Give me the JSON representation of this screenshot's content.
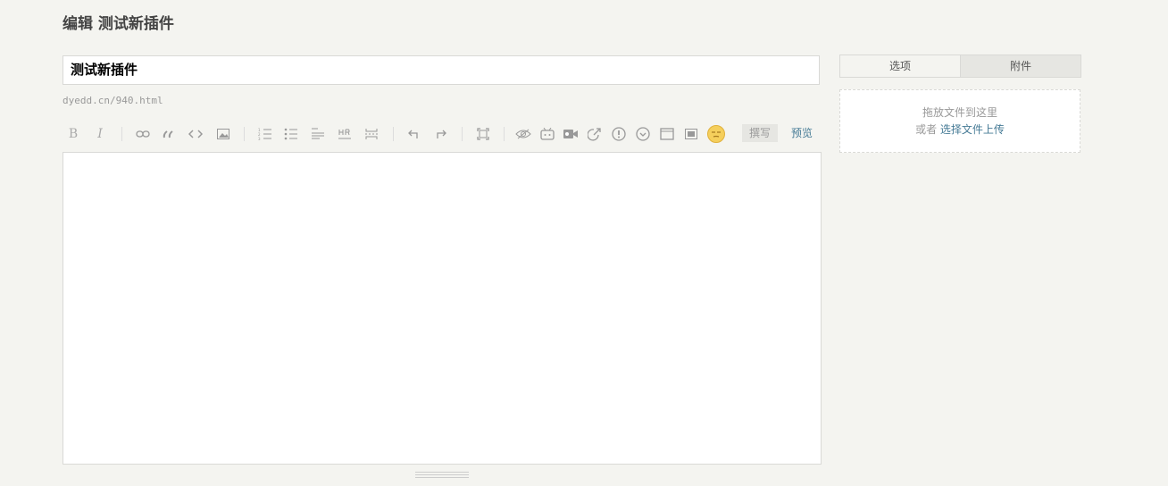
{
  "page": {
    "title": "编辑 测试新插件"
  },
  "post": {
    "title_value": "测试新插件",
    "slug": "dyedd.cn/940.html"
  },
  "toolbar": {
    "bold_label": "B",
    "italic_label": "I",
    "write_label": "撰写",
    "preview_label": "预览",
    "icons": [
      "bold-icon",
      "italic-icon",
      "link-icon",
      "quote-icon",
      "code-icon",
      "image-icon",
      "ordered-list-icon",
      "unordered-list-icon",
      "heading-icon",
      "hr-icon",
      "more-icon",
      "undo-icon",
      "redo-icon",
      "fullscreen-icon",
      "hide-icon",
      "bilibili-icon",
      "video-icon",
      "external-link-icon",
      "alert-icon",
      "collapse-icon",
      "card-icon",
      "gallery-icon",
      "emoji-icon"
    ]
  },
  "sidebar": {
    "tabs": [
      {
        "label": "选项"
      },
      {
        "label": "附件"
      }
    ],
    "upload": {
      "hint": "拖放文件到这里",
      "or_label": "或者",
      "link_label": "选择文件上传"
    }
  },
  "colors": {
    "background": "#f4f4f0",
    "link": "#467b96",
    "border": "#d9d9d6"
  }
}
